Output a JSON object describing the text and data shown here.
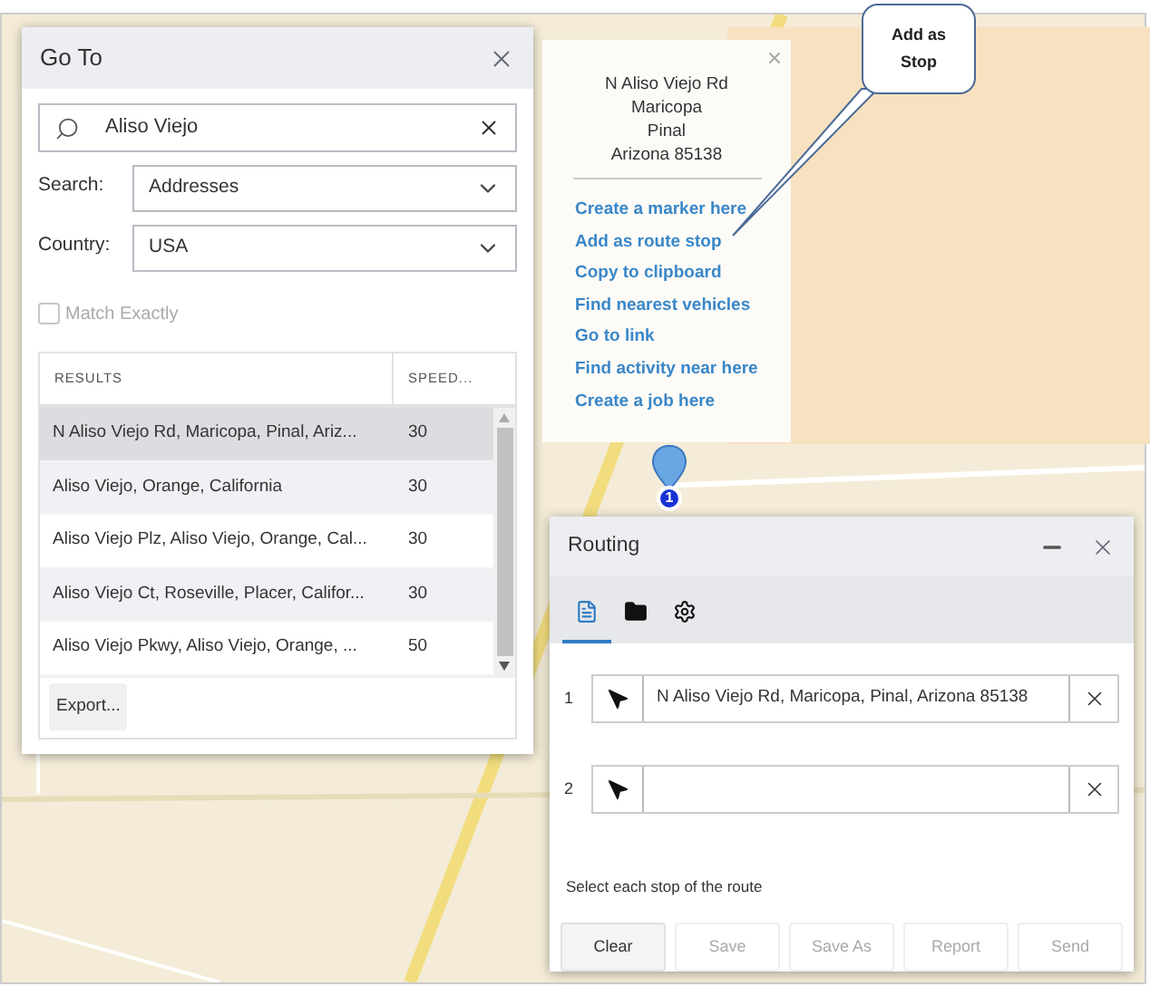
{
  "goto_dialog": {
    "title": "Go To",
    "search_value": "Aliso Viejo",
    "search_type": {
      "label": "Search:",
      "value": "Addresses"
    },
    "country": {
      "label": "Country:",
      "value": "USA"
    },
    "match_exactly": {
      "label": "Match Exactly",
      "checked": false,
      "disabled": true
    },
    "table": {
      "columns": [
        "RESULTS",
        "SPEED..."
      ],
      "rows": [
        {
          "result": "N Aliso Viejo Rd, Maricopa, Pinal, Ariz...",
          "speed": "30",
          "selected": true
        },
        {
          "result": "Aliso Viejo, Orange, California",
          "speed": "30",
          "selected": false
        },
        {
          "result": "Aliso Viejo Plz, Aliso Viejo, Orange, Cal...",
          "speed": "30",
          "selected": false
        },
        {
          "result": "Aliso Viejo Ct, Roseville, Placer, Califor...",
          "speed": "30",
          "selected": false
        },
        {
          "result": "Aliso Viejo Pkwy, Aliso Viejo, Orange, ...",
          "speed": "50",
          "selected": false
        }
      ]
    },
    "export_button": "Export..."
  },
  "map_popup": {
    "address_lines": [
      "N Aliso Viejo Rd",
      "Maricopa",
      "Pinal",
      "Arizona 85138"
    ],
    "links": [
      "Create a marker here",
      "Add as route stop",
      "Copy to clipboard",
      "Find nearest vehicles",
      "Go to link",
      "Find activity near here",
      "Create a job here"
    ]
  },
  "callout": {
    "lines": [
      "Add as",
      "Stop"
    ]
  },
  "map_marker": {
    "label": "1"
  },
  "routing": {
    "title": "Routing",
    "tabs": [
      {
        "kind": "document",
        "selected": true
      },
      {
        "kind": "folder",
        "selected": false
      },
      {
        "kind": "settings",
        "selected": false
      }
    ],
    "stops": [
      {
        "number": "1",
        "value": "N Aliso Viejo Rd, Maricopa, Pinal, Arizona 85138"
      },
      {
        "number": "2"
      }
    ],
    "hint": "Select each stop of the route",
    "buttons": [
      {
        "label": "Clear",
        "disabled": false
      },
      {
        "label": "Save",
        "disabled": true
      },
      {
        "label": "Save As",
        "disabled": true
      },
      {
        "label": "Report",
        "disabled": true
      },
      {
        "label": "Send",
        "disabled": true
      }
    ]
  }
}
